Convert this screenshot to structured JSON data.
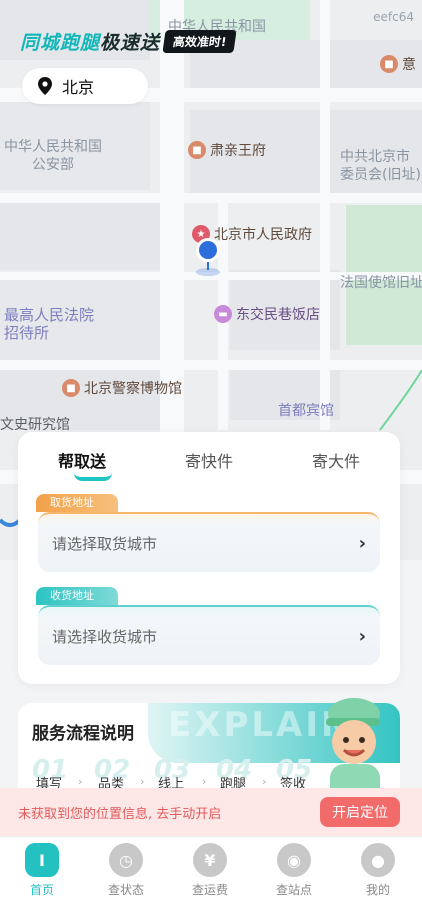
{
  "map": {
    "watermark": "eefc64",
    "labels": {
      "top_center": "中华人民共和国",
      "top_right_poi": "意",
      "ministry": "中华人民共和国\n公安部",
      "ccp_beijing": "中共北京市\n委员会(旧址)",
      "supreme_court": "最高人民法院\n招待所",
      "french_embassy": "法国使馆旧址",
      "capital_hotel": "首都宾馆",
      "culture_history": "文史研究馆"
    },
    "pois": {
      "prince_su": "肃亲王府",
      "gov": "北京市人民政府",
      "hotel": "东交民巷饭店",
      "police_museum": "北京警察博物馆"
    }
  },
  "banner": {
    "slogan_part1": "同城跑腿",
    "slogan_part2": "极速送",
    "tag": "高效准时!"
  },
  "city": {
    "name": "北京"
  },
  "tabs": [
    "帮取送",
    "寄快件",
    "寄大件"
  ],
  "pickup": {
    "tag": "取货地址",
    "placeholder": "请选择取货城市"
  },
  "deliver": {
    "tag": "收货地址",
    "placeholder": "请选择收货城市"
  },
  "process": {
    "title": "服务流程说明",
    "hero_word": "EXPLAIN",
    "steps": [
      {
        "num": "01",
        "label": "填写"
      },
      {
        "num": "02",
        "label": "品类"
      },
      {
        "num": "03",
        "label": "线上"
      },
      {
        "num": "04",
        "label": "跑腿"
      },
      {
        "num": "05",
        "label": "签收"
      }
    ]
  },
  "notice": {
    "message": "未获取到您的位置信息, 去手动开启",
    "button": "开启定位"
  },
  "nav": [
    {
      "label": "首页",
      "icon": "home-icon"
    },
    {
      "label": "查状态",
      "icon": "clock-icon"
    },
    {
      "label": "查运费",
      "icon": "yen-icon"
    },
    {
      "label": "查站点",
      "icon": "location-icon"
    },
    {
      "label": "我的",
      "icon": "user-icon"
    }
  ],
  "colors": {
    "accent": "#23c1c0",
    "pickup": "#f3a14a",
    "alert": "#f26b6b"
  }
}
